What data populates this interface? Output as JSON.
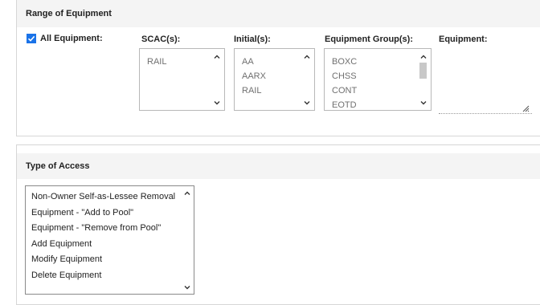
{
  "range_section": {
    "title": "Range of Equipment",
    "all_equipment_label": "All Equipment:",
    "all_equipment_checked": true,
    "scac_label": "SCAC(s):",
    "scac_items": [
      "RAIL"
    ],
    "initials_label": "Initial(s):",
    "initials_items": [
      "AA",
      "AARX",
      "RAIL"
    ],
    "equipment_group_label": "Equipment Group(s):",
    "equipment_group_items": [
      "BOXC",
      "CHSS",
      "CONT",
      "EOTD"
    ],
    "equipment_label": "Equipment:",
    "equipment_value": ""
  },
  "access_section": {
    "title": "Type of Access",
    "items": [
      "Non-Owner Self-as-Lessee Removal",
      "Equipment - \"Add to Pool\"",
      "Equipment - \"Remove from Pool\"",
      "Add Equipment",
      "Modify Equipment",
      "Delete Equipment"
    ]
  },
  "colors": {
    "accent": "#1a73e8",
    "header_bg": "#f4f4f4"
  },
  "icons": [
    "check-icon",
    "chevron-up-icon",
    "chevron-down-icon",
    "resize-handle-icon"
  ]
}
